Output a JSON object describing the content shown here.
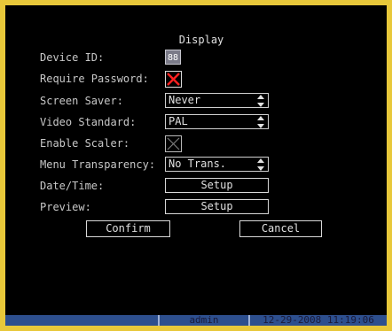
{
  "title": "Display",
  "fields": {
    "device_id_label": "Device ID:",
    "device_id_value": "88",
    "require_password_label": "Require Password:",
    "screen_saver_label": "Screen Saver:",
    "screen_saver_value": "Never",
    "video_standard_label": "Video Standard:",
    "video_standard_value": "PAL",
    "enable_scaler_label": "Enable Scaler:",
    "menu_transparency_label": "Menu Transparency:",
    "menu_transparency_value": "No Trans.",
    "date_time_label": "Date/Time:",
    "date_time_button": "Setup",
    "preview_label": "Preview:",
    "preview_button": "Setup"
  },
  "checkboxes": {
    "require_password": true,
    "enable_scaler": false
  },
  "actions": {
    "confirm": "Confirm",
    "cancel": "Cancel"
  },
  "status": {
    "user": "admin",
    "datetime": "12-29-2008 11:19:06"
  },
  "colors": {
    "frame": "#e8c83a",
    "checkbox_on": "#ff2020",
    "statusbar": "#2d4f8e"
  },
  "icons": {
    "require_password": "x-mark-icon",
    "enable_scaler": "x-mark-icon",
    "select_arrow": "updown-arrow-icon"
  }
}
